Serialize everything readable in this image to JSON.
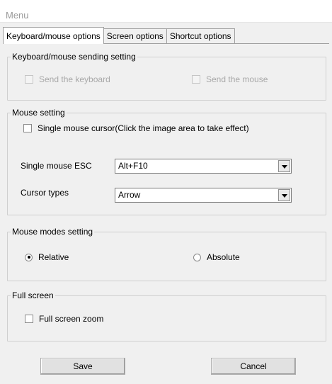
{
  "window": {
    "title": "Menu"
  },
  "tabs": [
    {
      "label": "Keyboard/mouse options",
      "active": true
    },
    {
      "label": "Screen options",
      "active": false
    },
    {
      "label": "Shortcut options",
      "active": false
    }
  ],
  "sending": {
    "legend": "Keyboard/mouse sending setting",
    "send_keyboard": {
      "label": "Send the keyboard",
      "checked": false,
      "enabled": false
    },
    "send_mouse": {
      "label": "Send the mouse",
      "checked": false,
      "enabled": false
    }
  },
  "mouse_setting": {
    "legend": "Mouse setting",
    "single_cursor": {
      "label": "Single mouse cursor(Click the image area to take effect)",
      "checked": false
    },
    "esc_label": "Single mouse ESC",
    "esc_value": "Alt+F10",
    "cursor_label": "Cursor types",
    "cursor_value": "Arrow"
  },
  "mouse_modes": {
    "legend": "Mouse modes setting",
    "relative": {
      "label": "Relative",
      "selected": true
    },
    "absolute": {
      "label": "Absolute",
      "selected": false
    }
  },
  "full_screen": {
    "legend": "Full screen",
    "zoom": {
      "label": "Full screen zoom",
      "checked": false
    }
  },
  "buttons": {
    "save": "Save",
    "cancel": "Cancel"
  }
}
